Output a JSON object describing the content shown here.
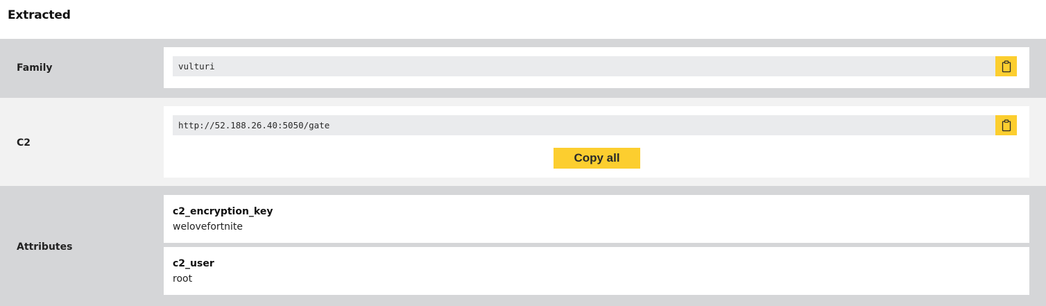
{
  "section": {
    "title": "Extracted"
  },
  "family": {
    "label": "Family",
    "value": "vulturi",
    "copy_icon": "clipboard-icon"
  },
  "c2": {
    "label": "C2",
    "value": "http://52.188.26.40:5050/gate",
    "copy_icon": "clipboard-icon",
    "copy_all_label": "Copy all"
  },
  "attributes": {
    "label": "Attributes",
    "items": [
      {
        "key": "c2_encryption_key",
        "value": "welovefortnite"
      },
      {
        "key": "c2_user",
        "value": "root"
      }
    ]
  },
  "colors": {
    "accent": "#fcce2f",
    "row_dark": "#d5d6d8",
    "row_light": "#f2f2f2",
    "value_bg": "#eaebed"
  }
}
